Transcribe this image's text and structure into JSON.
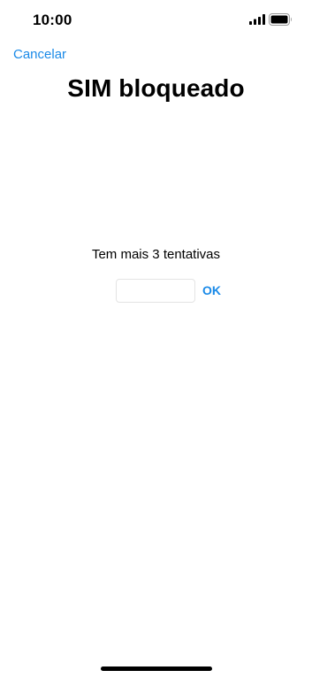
{
  "status_bar": {
    "time": "10:00",
    "signal_icon": "cellular-signal-icon",
    "battery_icon": "battery-full-icon"
  },
  "nav": {
    "cancel_label": "Cancelar"
  },
  "title": "SIM bloqueado",
  "message": "Tem mais 3 tentativas",
  "pin": {
    "value": "",
    "placeholder": ""
  },
  "ok_label": "OK",
  "colors": {
    "accent": "#1a8ae8",
    "text": "#000000",
    "background": "#ffffff",
    "input_border": "#e4e4e4"
  }
}
